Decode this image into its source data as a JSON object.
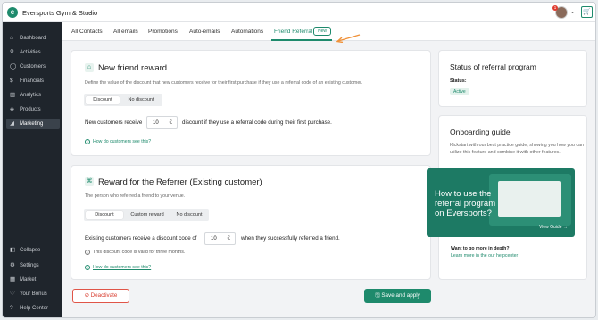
{
  "topbar": {
    "studio_name": "Eversports Gym & Studio",
    "notifications": "1"
  },
  "sidebar": {
    "items": [
      {
        "label": "Dashboard",
        "icon": "home-icon"
      },
      {
        "label": "Activities",
        "icon": "activity-icon"
      },
      {
        "label": "Customers",
        "icon": "user-icon"
      },
      {
        "label": "Financials",
        "icon": "money-icon"
      },
      {
        "label": "Analytics",
        "icon": "chart-icon"
      },
      {
        "label": "Products",
        "icon": "tag-icon"
      },
      {
        "label": "Marketing",
        "icon": "megaphone-icon"
      }
    ],
    "bottom": [
      {
        "label": "Collapse",
        "icon": "collapse-icon"
      },
      {
        "label": "Settings",
        "icon": "gear-icon"
      },
      {
        "label": "Market",
        "icon": "store-icon"
      },
      {
        "label": "Your Bonus",
        "icon": "heart-icon"
      },
      {
        "label": "Help Center",
        "icon": "help-icon"
      }
    ]
  },
  "tabs": {
    "items": [
      "All Contacts",
      "All emails",
      "Promotions",
      "Auto-emails",
      "Automations",
      "Friend Referral"
    ],
    "active": "Friend Referral",
    "new_badge": "New"
  },
  "new_friend": {
    "title": "New friend reward",
    "description": "Define the value of the discount that new customers receive for their first purchase if they use a referral code of an existing customer.",
    "options": [
      "Discount",
      "No discount"
    ],
    "line_before": "New customers receive",
    "value": "10",
    "unit": "€",
    "line_after": "discount if they use a referral code during their first purchase.",
    "help": "How do customers see this?"
  },
  "referrer": {
    "title": "Reward for the Referrer (Existing customer)",
    "description": "The person who referred a friend to your venue.",
    "options": [
      "Discount",
      "Custom reward",
      "No discount"
    ],
    "line_before": "Existing customers receive a discount code of",
    "value": "10",
    "unit": "€",
    "line_after": "when they successfully referred a friend.",
    "note": "This discount code is valid for three months.",
    "help": "How do customers see this?"
  },
  "status": {
    "title": "Status of referral program",
    "label": "Status:",
    "badge": "Active"
  },
  "onboarding": {
    "title": "Onboarding guide",
    "description": "Kickstart with our best practice guide, showing you how you can utilize this feature and combine it with other features.",
    "promo_text": "How to use the referral program on Eversports?",
    "promo_link": "View Guide →",
    "want_more": "Want to go more in depth?",
    "helpcenter_link": "Learn more in the our helpcenter"
  },
  "actions": {
    "deactivate": "Deactivate",
    "save": "Save and apply"
  },
  "colors": {
    "brand": "#1e8a6c",
    "danger": "#d83c2e",
    "sidebar": "#1f252c"
  }
}
